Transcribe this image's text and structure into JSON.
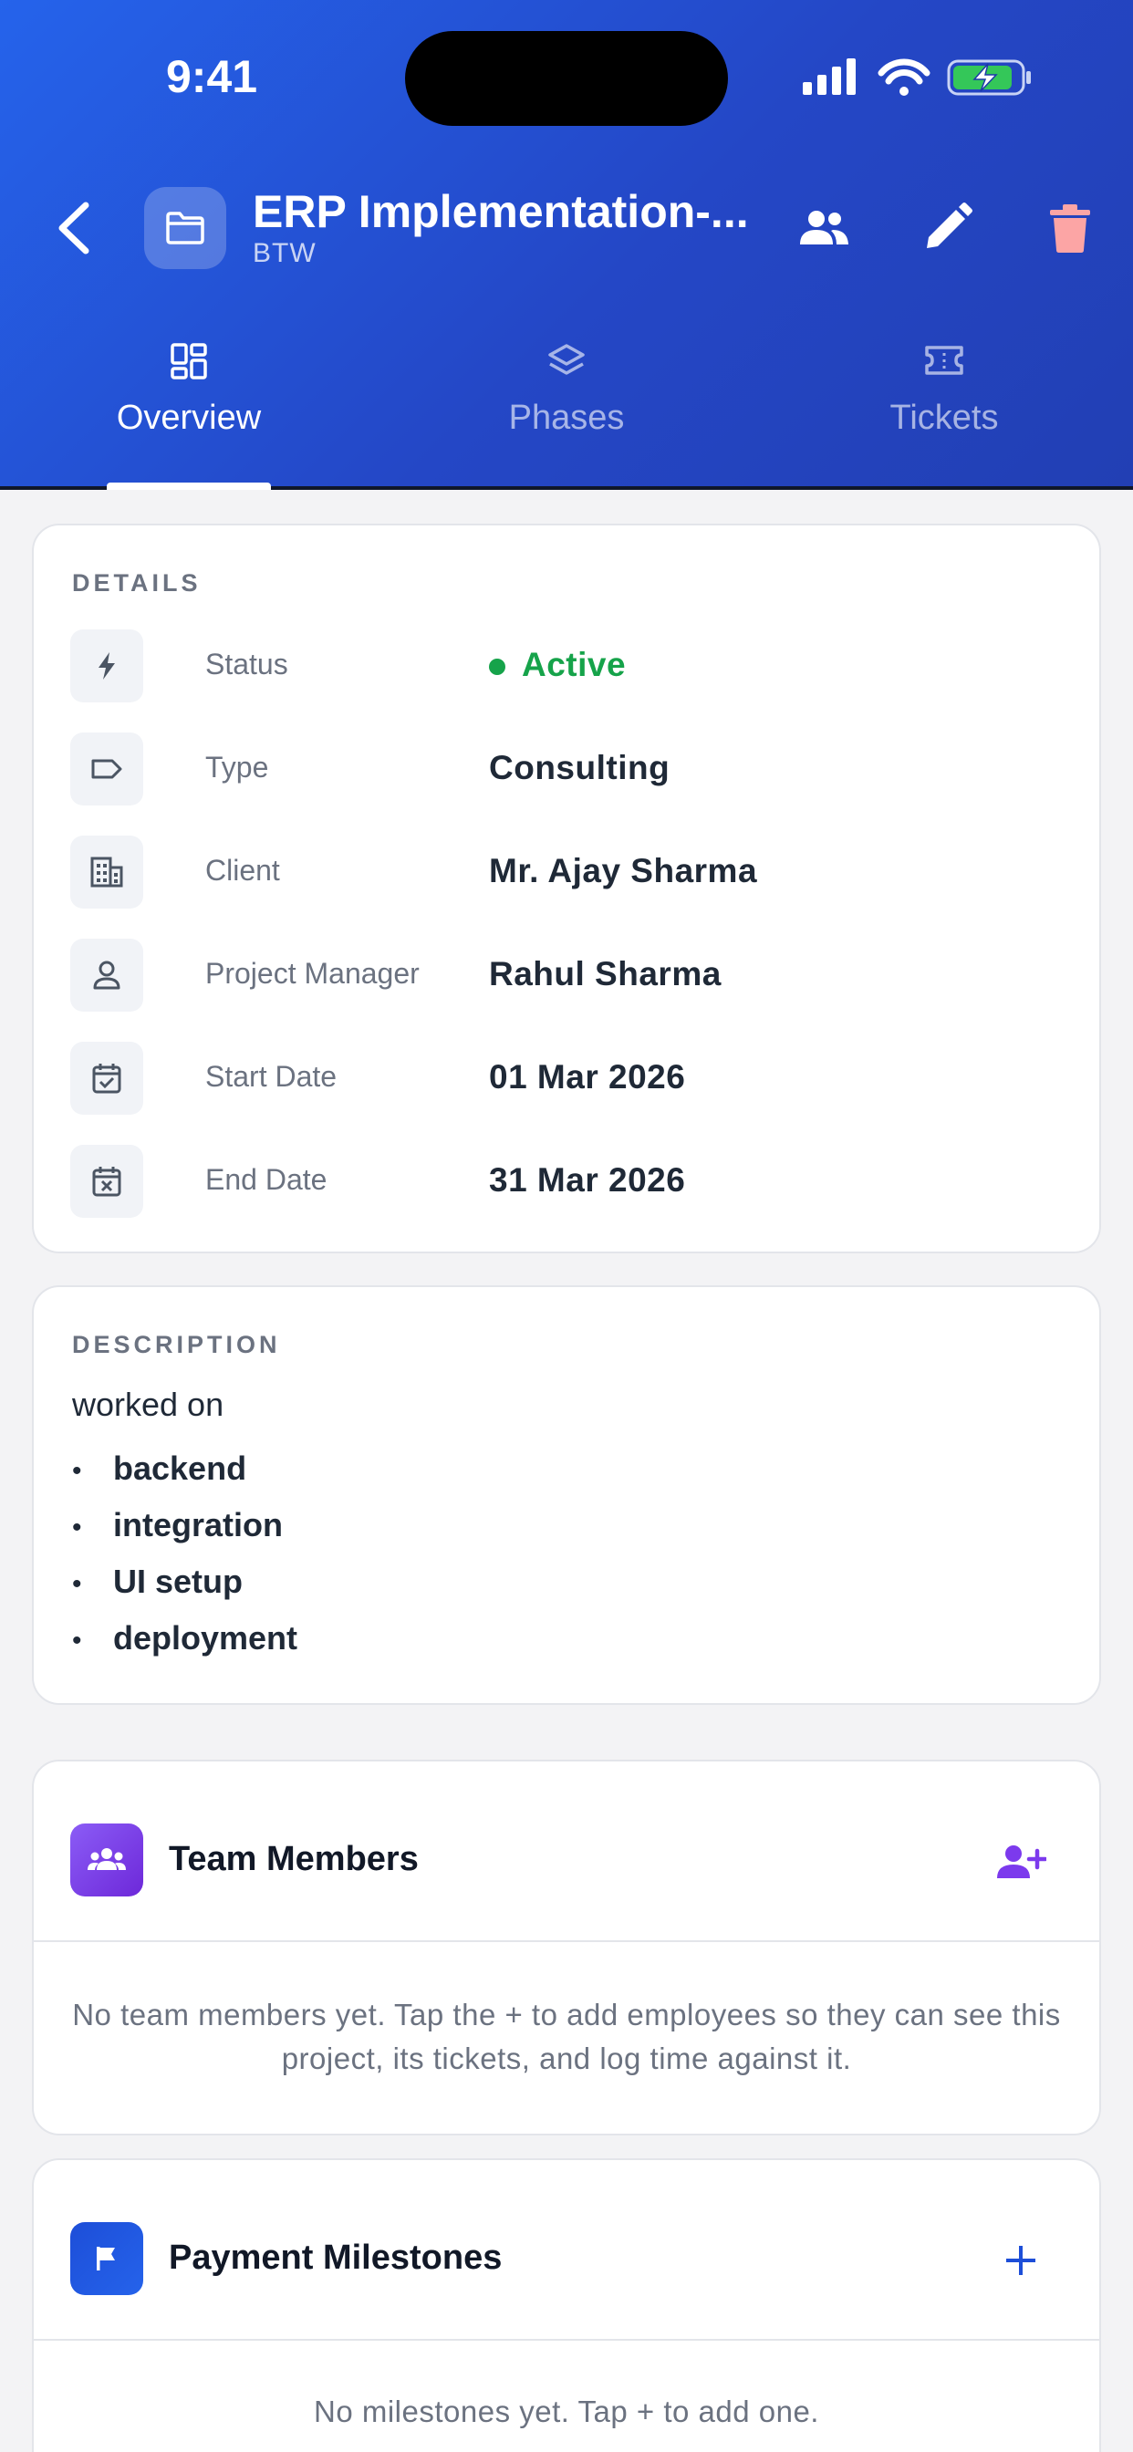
{
  "status_bar": {
    "time": "9:41"
  },
  "header": {
    "title": "ERP Implementation-...",
    "subtitle": "BTW",
    "icons": [
      "back-arrow-icon",
      "folder-icon",
      "team-icon",
      "edit-pencil-icon",
      "trash-icon"
    ]
  },
  "tabs": [
    {
      "label": "Overview",
      "icon": "dashboard-grid-icon",
      "active": true
    },
    {
      "label": "Phases",
      "icon": "layers-icon",
      "active": false
    },
    {
      "label": "Tickets",
      "icon": "ticket-icon",
      "active": false
    }
  ],
  "details": {
    "section_label": "DETAILS",
    "rows": [
      {
        "key": "Status",
        "value": "Active",
        "icon": "bolt-icon"
      },
      {
        "key": "Type",
        "value": "Consulting",
        "icon": "tag-icon"
      },
      {
        "key": "Client",
        "value": "Mr. Ajay Sharma",
        "icon": "building-icon"
      },
      {
        "key": "Project Manager",
        "value": "Rahul Sharma",
        "icon": "person-icon"
      },
      {
        "key": "Start Date",
        "value": "01 Mar 2026",
        "icon": "calendar-check-icon"
      },
      {
        "key": "End Date",
        "value": "31 Mar 2026",
        "icon": "calendar-x-icon"
      }
    ]
  },
  "description": {
    "section_label": "DESCRIPTION",
    "intro": "worked on",
    "bullets": [
      "backend",
      "integration",
      "UI setup",
      "deployment"
    ]
  },
  "team_members": {
    "title": "Team Members",
    "empty_message": "No team members yet. Tap the + to add employees so they can see this project, its tickets, and log time against it."
  },
  "payment_milestones": {
    "title": "Payment Milestones",
    "empty_message": "No milestones yet. Tap + to add one."
  },
  "colors": {
    "header_start": "#2563eb",
    "header_end": "#223fb4",
    "status_active": "#16a34a",
    "team_accent": "#7c3aed",
    "milestone_accent": "#1d4ed8",
    "delete": "#fca5a5"
  }
}
